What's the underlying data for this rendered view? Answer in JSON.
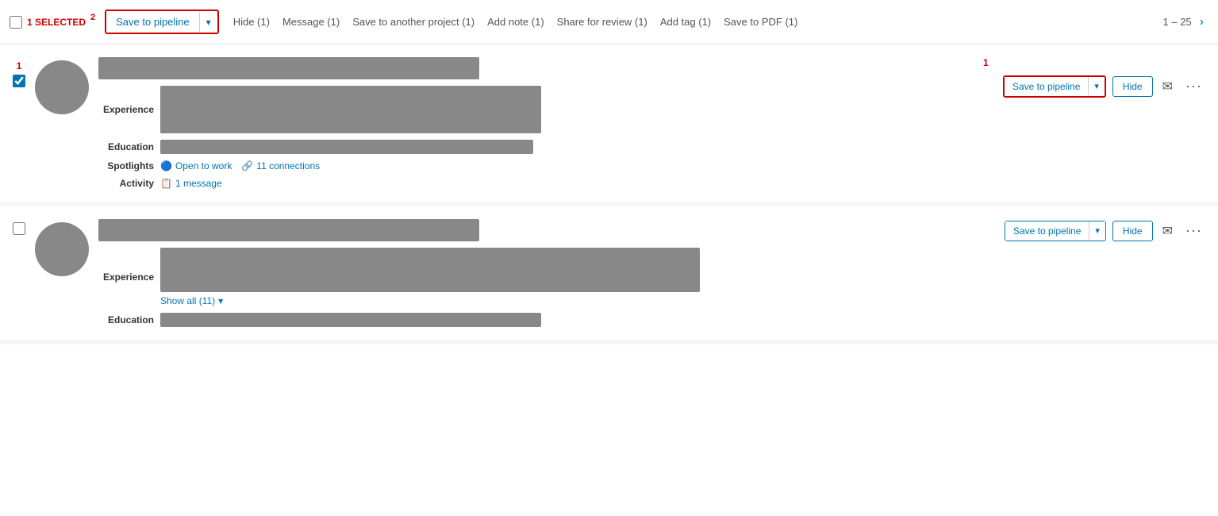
{
  "toolbar": {
    "select_all_label": "",
    "selected_count": "1 SELECTED",
    "selected_number": "2",
    "save_to_pipeline_label": "Save to pipeline",
    "hide_label": "Hide (1)",
    "message_label": "Message (1)",
    "save_to_another_project_label": "Save to another project (1)",
    "add_note_label": "Add note (1)",
    "share_for_review_label": "Share for review (1)",
    "add_tag_label": "Add tag (1)",
    "save_to_pdf_label": "Save to PDF (1)",
    "pagination": "1 – 25",
    "dropdown_arrow": "▾",
    "nav_next": "›"
  },
  "card1": {
    "number": "1",
    "selected_number_badge": "1",
    "experience_label": "Experience",
    "education_label": "Education",
    "spotlights_label": "Spotlights",
    "activity_label": "Activity",
    "open_to_work": "Open to work",
    "connections": "11 connections",
    "message": "1 message",
    "save_to_pipeline": "Save to pipeline",
    "hide": "Hide",
    "dropdown_arrow": "▾",
    "card_action_number": "1"
  },
  "card2": {
    "experience_label": "Experience",
    "education_label": "Education",
    "show_all": "Show all (11)",
    "save_to_pipeline": "Save to pipeline",
    "hide": "Hide",
    "dropdown_arrow": "▾"
  },
  "icons": {
    "open_to_work": "🔵",
    "connections": "🔗",
    "message_icon": "📋",
    "mail": "✉",
    "more": "•••",
    "chevron_down": "▾"
  }
}
